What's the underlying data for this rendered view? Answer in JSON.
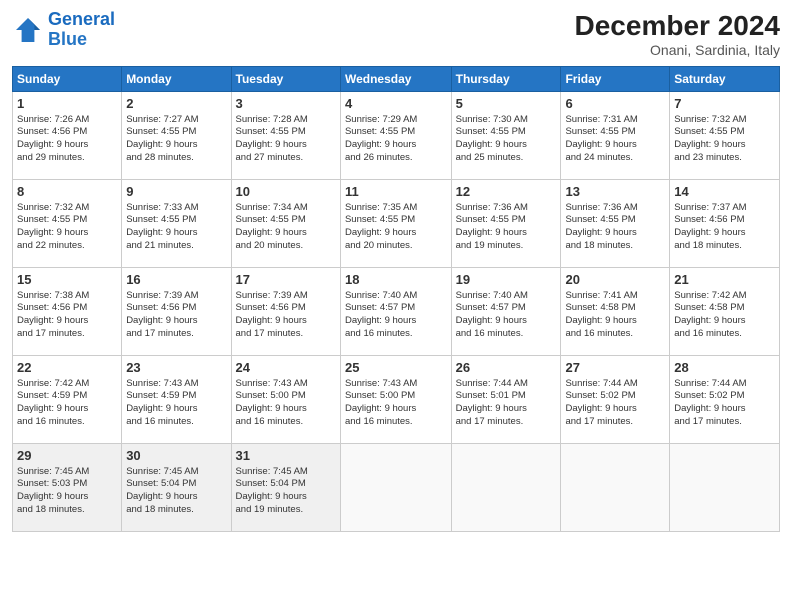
{
  "logo": {
    "line1": "General",
    "line2": "Blue"
  },
  "title": "December 2024",
  "subtitle": "Onani, Sardinia, Italy",
  "weekdays": [
    "Sunday",
    "Monday",
    "Tuesday",
    "Wednesday",
    "Thursday",
    "Friday",
    "Saturday"
  ],
  "weeks": [
    [
      {
        "day": "1",
        "info": "Sunrise: 7:26 AM\nSunset: 4:56 PM\nDaylight: 9 hours\nand 29 minutes."
      },
      {
        "day": "2",
        "info": "Sunrise: 7:27 AM\nSunset: 4:55 PM\nDaylight: 9 hours\nand 28 minutes."
      },
      {
        "day": "3",
        "info": "Sunrise: 7:28 AM\nSunset: 4:55 PM\nDaylight: 9 hours\nand 27 minutes."
      },
      {
        "day": "4",
        "info": "Sunrise: 7:29 AM\nSunset: 4:55 PM\nDaylight: 9 hours\nand 26 minutes."
      },
      {
        "day": "5",
        "info": "Sunrise: 7:30 AM\nSunset: 4:55 PM\nDaylight: 9 hours\nand 25 minutes."
      },
      {
        "day": "6",
        "info": "Sunrise: 7:31 AM\nSunset: 4:55 PM\nDaylight: 9 hours\nand 24 minutes."
      },
      {
        "day": "7",
        "info": "Sunrise: 7:32 AM\nSunset: 4:55 PM\nDaylight: 9 hours\nand 23 minutes."
      }
    ],
    [
      {
        "day": "8",
        "info": "Sunrise: 7:32 AM\nSunset: 4:55 PM\nDaylight: 9 hours\nand 22 minutes."
      },
      {
        "day": "9",
        "info": "Sunrise: 7:33 AM\nSunset: 4:55 PM\nDaylight: 9 hours\nand 21 minutes."
      },
      {
        "day": "10",
        "info": "Sunrise: 7:34 AM\nSunset: 4:55 PM\nDaylight: 9 hours\nand 20 minutes."
      },
      {
        "day": "11",
        "info": "Sunrise: 7:35 AM\nSunset: 4:55 PM\nDaylight: 9 hours\nand 20 minutes."
      },
      {
        "day": "12",
        "info": "Sunrise: 7:36 AM\nSunset: 4:55 PM\nDaylight: 9 hours\nand 19 minutes."
      },
      {
        "day": "13",
        "info": "Sunrise: 7:36 AM\nSunset: 4:55 PM\nDaylight: 9 hours\nand 18 minutes."
      },
      {
        "day": "14",
        "info": "Sunrise: 7:37 AM\nSunset: 4:56 PM\nDaylight: 9 hours\nand 18 minutes."
      }
    ],
    [
      {
        "day": "15",
        "info": "Sunrise: 7:38 AM\nSunset: 4:56 PM\nDaylight: 9 hours\nand 17 minutes."
      },
      {
        "day": "16",
        "info": "Sunrise: 7:39 AM\nSunset: 4:56 PM\nDaylight: 9 hours\nand 17 minutes."
      },
      {
        "day": "17",
        "info": "Sunrise: 7:39 AM\nSunset: 4:56 PM\nDaylight: 9 hours\nand 17 minutes."
      },
      {
        "day": "18",
        "info": "Sunrise: 7:40 AM\nSunset: 4:57 PM\nDaylight: 9 hours\nand 16 minutes."
      },
      {
        "day": "19",
        "info": "Sunrise: 7:40 AM\nSunset: 4:57 PM\nDaylight: 9 hours\nand 16 minutes."
      },
      {
        "day": "20",
        "info": "Sunrise: 7:41 AM\nSunset: 4:58 PM\nDaylight: 9 hours\nand 16 minutes."
      },
      {
        "day": "21",
        "info": "Sunrise: 7:42 AM\nSunset: 4:58 PM\nDaylight: 9 hours\nand 16 minutes."
      }
    ],
    [
      {
        "day": "22",
        "info": "Sunrise: 7:42 AM\nSunset: 4:59 PM\nDaylight: 9 hours\nand 16 minutes."
      },
      {
        "day": "23",
        "info": "Sunrise: 7:43 AM\nSunset: 4:59 PM\nDaylight: 9 hours\nand 16 minutes."
      },
      {
        "day": "24",
        "info": "Sunrise: 7:43 AM\nSunset: 5:00 PM\nDaylight: 9 hours\nand 16 minutes."
      },
      {
        "day": "25",
        "info": "Sunrise: 7:43 AM\nSunset: 5:00 PM\nDaylight: 9 hours\nand 16 minutes."
      },
      {
        "day": "26",
        "info": "Sunrise: 7:44 AM\nSunset: 5:01 PM\nDaylight: 9 hours\nand 17 minutes."
      },
      {
        "day": "27",
        "info": "Sunrise: 7:44 AM\nSunset: 5:02 PM\nDaylight: 9 hours\nand 17 minutes."
      },
      {
        "day": "28",
        "info": "Sunrise: 7:44 AM\nSunset: 5:02 PM\nDaylight: 9 hours\nand 17 minutes."
      }
    ],
    [
      {
        "day": "29",
        "info": "Sunrise: 7:45 AM\nSunset: 5:03 PM\nDaylight: 9 hours\nand 18 minutes."
      },
      {
        "day": "30",
        "info": "Sunrise: 7:45 AM\nSunset: 5:04 PM\nDaylight: 9 hours\nand 18 minutes."
      },
      {
        "day": "31",
        "info": "Sunrise: 7:45 AM\nSunset: 5:04 PM\nDaylight: 9 hours\nand 19 minutes."
      },
      {
        "day": "",
        "info": ""
      },
      {
        "day": "",
        "info": ""
      },
      {
        "day": "",
        "info": ""
      },
      {
        "day": "",
        "info": ""
      }
    ]
  ]
}
